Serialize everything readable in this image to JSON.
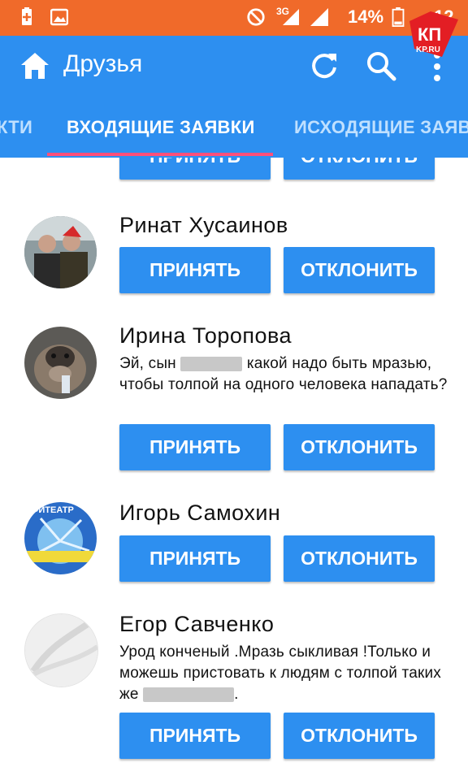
{
  "status_bar": {
    "network": "3G",
    "battery": "14%",
    "time": "12"
  },
  "app_bar": {
    "title": "Друзья",
    "icons": [
      "home-icon",
      "refresh-icon",
      "search-icon",
      "more-icon"
    ]
  },
  "tabs": [
    {
      "label": "КТИ",
      "active": false
    },
    {
      "label": "ВХОДЯЩИЕ ЗАЯВКИ",
      "active": true
    },
    {
      "label": "ИСХОДЯЩИЕ ЗАЯВ",
      "active": false
    }
  ],
  "buttons": {
    "accept": "ПРИНЯТЬ",
    "decline": "ОТКЛОНИТЬ"
  },
  "requests": [
    {
      "name": "",
      "message": ""
    },
    {
      "name": "Ринат Хусаинов",
      "message": ""
    },
    {
      "name": "Ирина Торопова",
      "message_parts": [
        "Эй, сын",
        "какой надо быть мразью, чтобы толпой на одного человека нападать?"
      ]
    },
    {
      "name": "Игорь Самохин",
      "message": "",
      "avatar_text": "ФИТЕАТР"
    },
    {
      "name": "Егор Савченко",
      "message_parts": [
        "Урод конченый .Мразь сыкливая !Только и можешь пристовать к людям с толпой таких же",
        "."
      ]
    }
  ],
  "watermark": {
    "line1": "КП",
    "line2": "KP.RU",
    "colors": {
      "primary": "#e31e24",
      "secondary": "#ffffff"
    }
  },
  "colors": {
    "status_bar": "#f06a2a",
    "accent": "#2d8ff0",
    "tab_indicator": "#ff4f7a"
  }
}
